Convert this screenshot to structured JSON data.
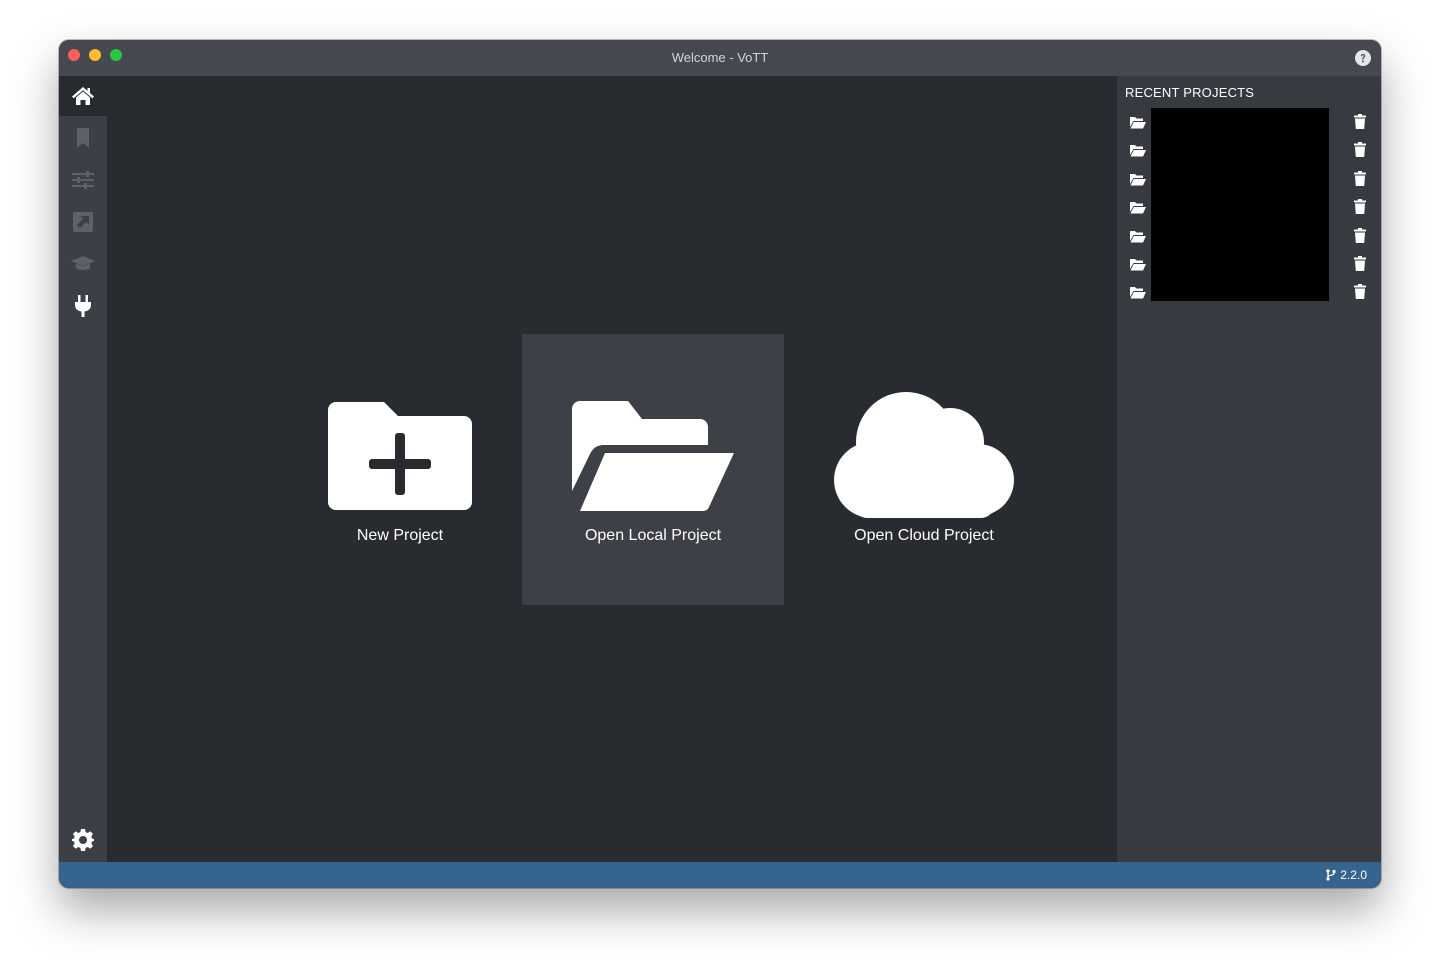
{
  "window": {
    "title": "Welcome - VoTT"
  },
  "sidebar": {
    "items": [
      {
        "name": "home",
        "icon": "home-icon",
        "active": true
      },
      {
        "name": "bookmark",
        "icon": "bookmark-icon",
        "active": false
      },
      {
        "name": "settings-sliders",
        "icon": "sliders-icon",
        "active": false
      },
      {
        "name": "export",
        "icon": "external-link-icon",
        "active": false
      },
      {
        "name": "active-learning",
        "icon": "graduation-cap-icon",
        "active": false
      },
      {
        "name": "connections",
        "icon": "plug-icon",
        "active": false
      }
    ],
    "bottom": {
      "name": "app-settings",
      "icon": "gear-icon"
    }
  },
  "main": {
    "actions": [
      {
        "label": "New Project",
        "icon": "folder-plus-icon"
      },
      {
        "label": "Open Local Project",
        "icon": "folder-open-icon"
      },
      {
        "label": "Open Cloud Project",
        "icon": "cloud-icon"
      }
    ]
  },
  "recent": {
    "title": "RECENT PROJECTS",
    "items": [
      {
        "name": ""
      },
      {
        "name": ""
      },
      {
        "name": ""
      },
      {
        "name": ""
      },
      {
        "name": ""
      },
      {
        "name": ""
      },
      {
        "name": ""
      }
    ]
  },
  "statusbar": {
    "version": "2.2.0"
  },
  "colors": {
    "main_bg": "#282b30",
    "sidebar_bg": "#3c3f45",
    "recent_bg": "#373a40",
    "statusbar_bg": "#35658f"
  }
}
